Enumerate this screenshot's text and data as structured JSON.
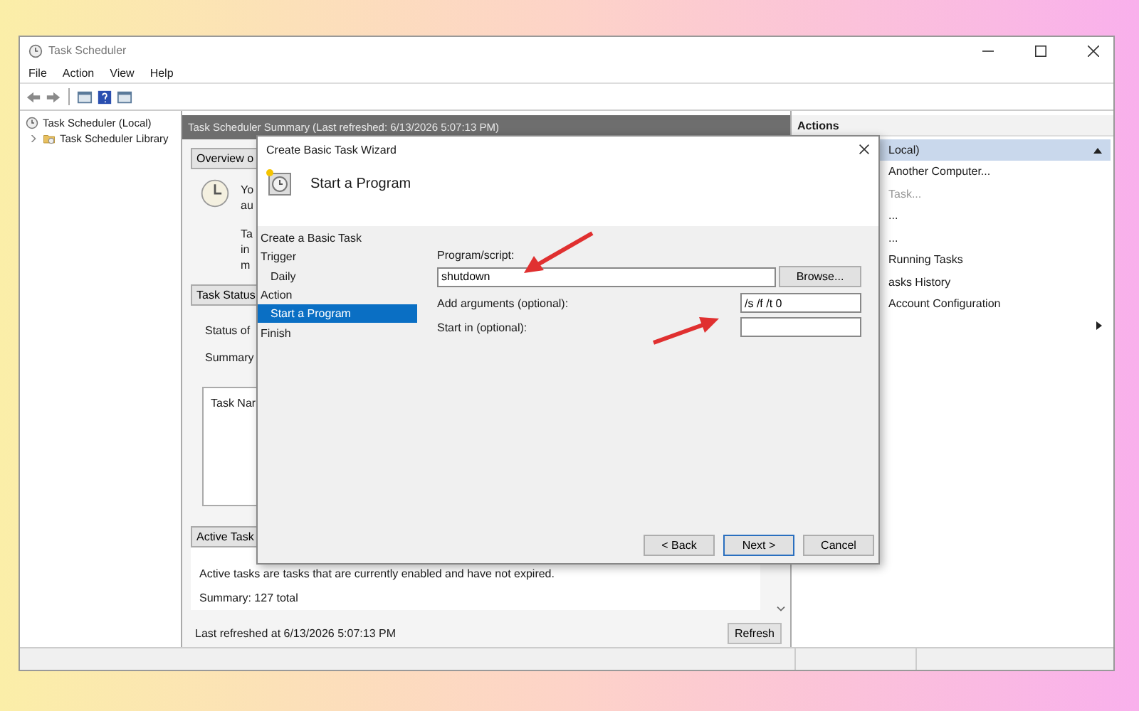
{
  "window": {
    "title": "Task Scheduler"
  },
  "menu": [
    "File",
    "Action",
    "View",
    "Help"
  ],
  "tree": [
    {
      "label": "Task Scheduler (Local)",
      "selected": false,
      "children": [
        {
          "label": "Task Scheduler Library",
          "selected": false,
          "expanded": false
        }
      ]
    }
  ],
  "summary": {
    "header": "Task Scheduler Summary (Last refreshed: 6/13/2026 5:07:13 PM)",
    "overview_button": "Overview o",
    "overview_lines": [
      "Yo",
      "au"
    ],
    "info_lines": [
      "Ta",
      "in",
      "m"
    ],
    "status_section": "Task Status",
    "status_label": "Status of",
    "summary_label": "Summary",
    "list_header": "Task Nar",
    "active_section": "Active Task",
    "active_text": "Active tasks are tasks that are currently enabled and have not expired.",
    "active_summary": "Summary: 127 total",
    "footer": "Last refreshed at 6/13/2026 5:07:13 PM",
    "refresh_button": "Refresh"
  },
  "actions": {
    "header": "Actions",
    "items": [
      {
        "kind": "group",
        "label": "Local)",
        "expanded": true
      },
      {
        "kind": "item",
        "label": "Another Computer...",
        "disabled": false
      },
      {
        "kind": "item",
        "label": "Task...",
        "disabled": true
      },
      {
        "kind": "item",
        "label": "...",
        "disabled": false
      },
      {
        "kind": "item",
        "label": "...",
        "disabled": false
      },
      {
        "kind": "item",
        "label": "Running Tasks",
        "disabled": false
      },
      {
        "kind": "item",
        "label": "asks History",
        "disabled": false
      },
      {
        "kind": "item",
        "label": "Account Configuration",
        "disabled": false
      },
      {
        "kind": "submenu"
      }
    ]
  },
  "wizard": {
    "title": "Create Basic Task Wizard",
    "heading": "Start a Program",
    "steps": [
      {
        "label": "Create a Basic Task",
        "selected": false
      },
      {
        "label": "Trigger",
        "selected": false,
        "children": [
          {
            "label": "Daily",
            "selected": false
          }
        ]
      },
      {
        "label": "Action",
        "selected": false,
        "children": [
          {
            "label": "Start a Program",
            "selected": true
          }
        ]
      },
      {
        "label": "Finish",
        "selected": false
      }
    ],
    "program_label": "Program/script:",
    "program_value": "shutdown",
    "browse_button": "Browse...",
    "arguments_label": "Add arguments (optional):",
    "arguments_value": "/s /f /t 0",
    "start_in_label": "Start in (optional):",
    "buttons": [
      {
        "label": "< Back",
        "default": false
      },
      {
        "label": "Next >",
        "default": true
      },
      {
        "label": "Cancel",
        "default": false
      }
    ]
  }
}
